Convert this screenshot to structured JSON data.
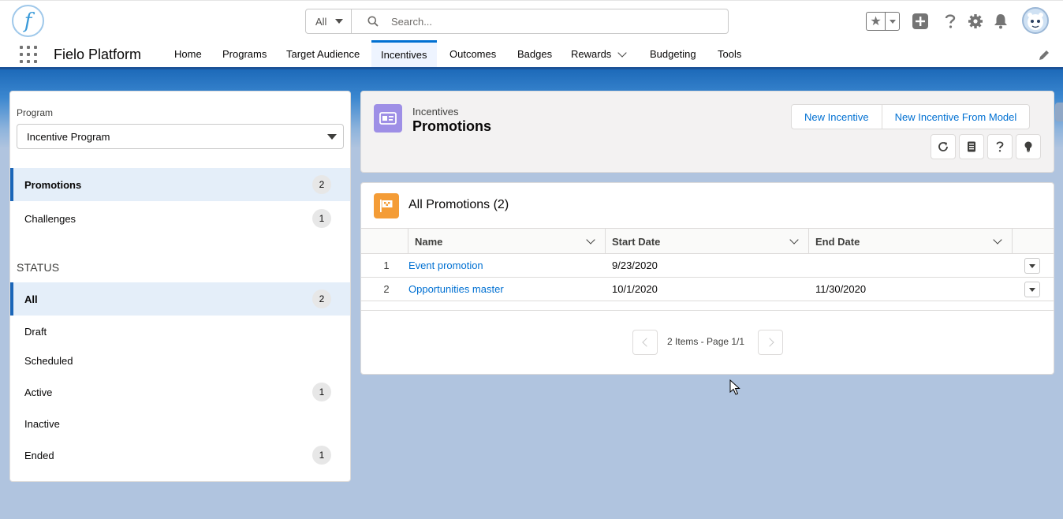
{
  "header": {
    "logo_letter": "f",
    "search": {
      "scope": "All",
      "placeholder": "Search..."
    }
  },
  "nav": {
    "app_name": "Fielo Platform",
    "items": [
      {
        "label": "Home"
      },
      {
        "label": "Programs"
      },
      {
        "label": "Target Audience"
      },
      {
        "label": "Incentives",
        "active": true
      },
      {
        "label": "Outcomes"
      },
      {
        "label": "Badges"
      },
      {
        "label": "Rewards",
        "has_menu": true
      },
      {
        "label": "Budgeting"
      },
      {
        "label": "Tools"
      }
    ]
  },
  "left_panel": {
    "program_label": "Program",
    "program_value": "Incentive Program",
    "types": [
      {
        "label": "Promotions",
        "count": "2",
        "selected": true
      },
      {
        "label": "Challenges",
        "count": "1"
      }
    ],
    "status_title": "STATUS",
    "statuses": [
      {
        "label": "All",
        "count": "2",
        "selected": true
      },
      {
        "label": "Draft"
      },
      {
        "label": "Scheduled"
      },
      {
        "label": "Active",
        "count": "1"
      },
      {
        "label": "Inactive"
      },
      {
        "label": "Ended",
        "count": "1"
      }
    ]
  },
  "page_header": {
    "eyebrow": "Incentives",
    "title": "Promotions",
    "new_button": "New Incentive",
    "new_from_model_button": "New Incentive From Model"
  },
  "list": {
    "title": "All Promotions (2)",
    "columns": [
      "Name",
      "Start Date",
      "End Date"
    ],
    "rows": [
      {
        "num": "1",
        "name": "Event promotion",
        "start": "9/23/2020",
        "end": ""
      },
      {
        "num": "2",
        "name": "Opportunities master",
        "start": "10/1/2020",
        "end": "11/30/2020"
      }
    ],
    "pagination": "2 Items - Page 1/1"
  },
  "colors": {
    "brand_blue": "#0070d2",
    "header_icon": "#9e8fe6",
    "list_icon": "#f49c36"
  }
}
